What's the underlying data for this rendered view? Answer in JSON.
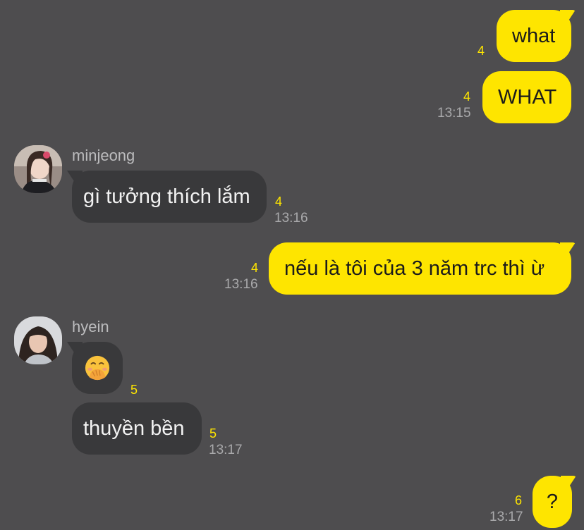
{
  "messages": [
    {
      "id": "m1",
      "direction": "out",
      "text": "what",
      "unread": "4",
      "time": ""
    },
    {
      "id": "m2",
      "direction": "out",
      "text": "WHAT",
      "unread": "4",
      "time": "13:15"
    },
    {
      "id": "m3",
      "direction": "in",
      "sender": "minjeong",
      "text": "gì tưởng thích lắm",
      "unread": "4",
      "time": "13:16"
    },
    {
      "id": "m4",
      "direction": "out",
      "text": "nếu là tôi của 3 năm trc thì ừ",
      "unread": "4",
      "time": "13:16"
    },
    {
      "id": "m5",
      "direction": "in",
      "sender": "hyein",
      "text": "",
      "emoji": "face-with-hand-over-mouth-emoji",
      "unread": "5",
      "time": ""
    },
    {
      "id": "m6",
      "direction": "in",
      "text": "thuyền bền",
      "unread": "5",
      "time": "13:17"
    },
    {
      "id": "m7",
      "direction": "out",
      "text": "?",
      "unread": "6",
      "time": "13:17"
    }
  ],
  "colors": {
    "background": "#4e4d4f",
    "outgoing_bubble": "#fee500",
    "incoming_bubble": "#39393b",
    "unread_count": "#fee500",
    "timestamp": "#a9a9ab"
  },
  "avatars": {
    "minjeong": "minjeong-avatar",
    "hyein": "hyein-avatar"
  }
}
